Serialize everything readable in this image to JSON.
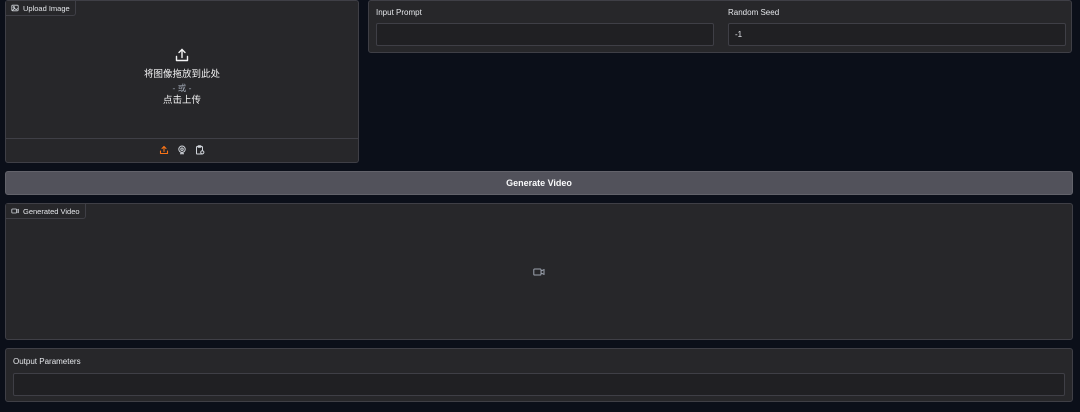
{
  "upload": {
    "tag_label": "Upload Image",
    "drop_line1": "将图像拖放到此处",
    "drop_line2": "- 或 -",
    "drop_line3": "点击上传",
    "sources": [
      "upload-icon",
      "webcam-icon",
      "clipboard-icon"
    ],
    "accent": "#f97316"
  },
  "prompt": {
    "label": "Input Prompt",
    "value": ""
  },
  "seed": {
    "label": "Random Seed",
    "value": "-1"
  },
  "generate": {
    "label": "Generate Video"
  },
  "video": {
    "tag_label": "Generated Video",
    "icon": "video-icon"
  },
  "output": {
    "label": "Output Parameters",
    "value": ""
  }
}
